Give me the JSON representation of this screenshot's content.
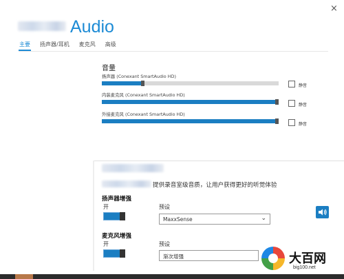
{
  "window": {
    "title": "Audio",
    "close_glyph": "×"
  },
  "tabs": [
    {
      "label": "主要",
      "active": true
    },
    {
      "label": "扬声器/耳机",
      "active": false
    },
    {
      "label": "麦克风",
      "active": false
    },
    {
      "label": "高级",
      "active": false
    }
  ],
  "volume": {
    "heading": "音量",
    "mute_label": "静音",
    "devices": [
      {
        "label": "扬声器 (Conexant SmartAudio HD)",
        "level": 0.22,
        "muted": false
      },
      {
        "label": "内装麦克风 (Conexant SmartAudio HD)",
        "level": 0.98,
        "muted": false
      },
      {
        "label": "外接麦克风 (Conexant SmartAudio HD)",
        "level": 0.98,
        "muted": false
      }
    ]
  },
  "enhancement": {
    "description": "提供录音室级音质，让用户获得更好的听觉体验",
    "speaker": {
      "title": "扬声器增强",
      "toggle_label": "开",
      "toggle_on": true,
      "preset_label": "预设",
      "preset_value": "MaxxSense"
    },
    "mic": {
      "title": "麦克风增强",
      "toggle_label": "开",
      "toggle_on": true,
      "preset_label": "预设",
      "preset_value": "渐次增强"
    }
  },
  "watermark": {
    "text": "大百网",
    "url": "big100.net"
  },
  "colors": {
    "accent": "#1d8bd5",
    "fill": "#1b7ec2",
    "track": "#d9d9d9"
  },
  "icons": [
    "close-icon",
    "speaker-icon",
    "chevron-down-icon",
    "checkbox-icon"
  ]
}
